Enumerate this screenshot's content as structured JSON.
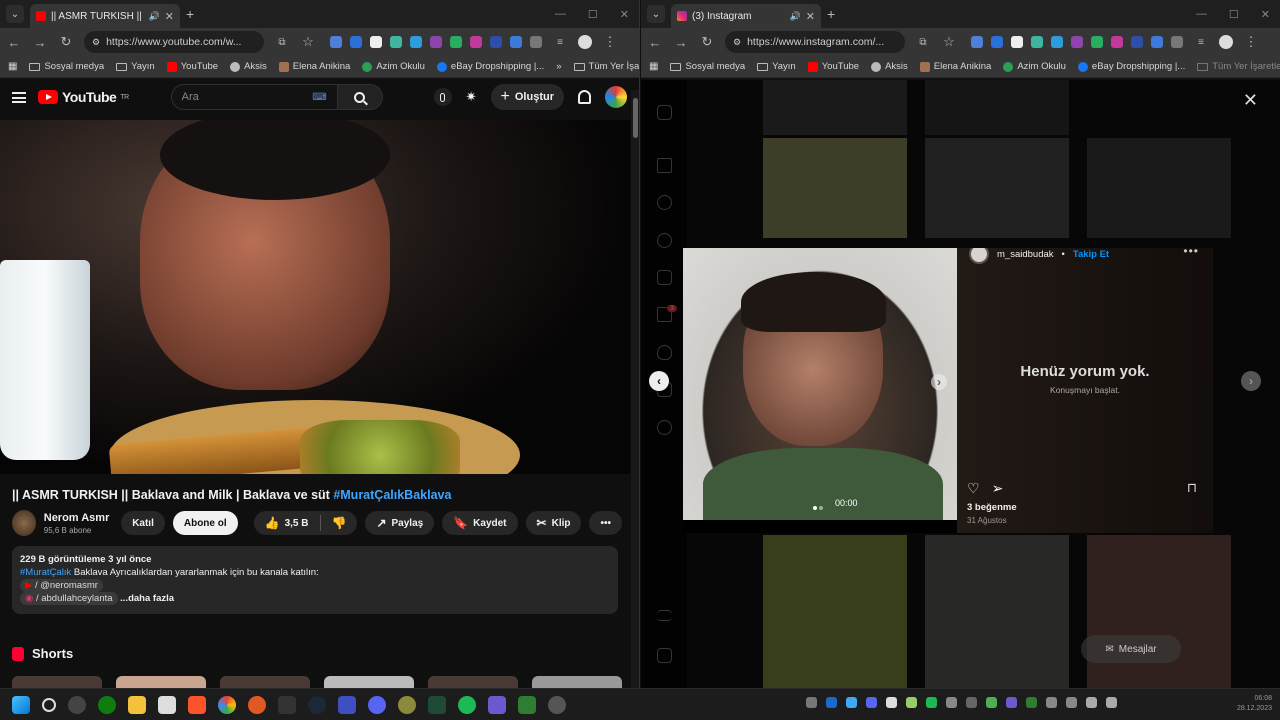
{
  "left_window": {
    "tab_title": "|| ASMR TURKISH || Baklav",
    "url": "https://www.youtube.com/w...",
    "bookmarks": [
      "Sosyal medya",
      "Yayın",
      "YouTube",
      "Aksis",
      "Elena Anikina",
      "Azim Okulu",
      "eBay Dropshipping |...",
      "Tüm Yer İşaretleri"
    ],
    "youtube": {
      "logo": "YouTube",
      "logo_region": "TR",
      "search_placeholder": "Ara",
      "create_label": "Oluştur",
      "video_title_main": "|| ASMR TURKISH || Baklava and Milk | Baklava ve süt",
      "video_title_tag": "#MuratÇalıkBaklava",
      "channel_name": "Nerom Asmr",
      "channel_subs": "95,6 B abone",
      "join_label": "Katıl",
      "subscribe_label": "Abone ol",
      "likes": "3,5 B",
      "share_label": "Paylaş",
      "save_label": "Kaydet",
      "clip_label": "Klip",
      "desc_views": "229 B görüntüleme  3 yıl önce",
      "desc_tag": "#MuratÇalık",
      "desc_line1": " Baklava Ayrıcalıklardan yararlanmak için bu kanala katılın:",
      "desc_line2": "/ @neromasmr",
      "desc_line3": "/ abdullahceylanta",
      "desc_more": "...daha fazla",
      "shorts_label": "Shorts"
    }
  },
  "right_window": {
    "tab_title": "(3) Instagram",
    "url": "https://www.instagram.com/...",
    "bookmarks": [
      "Sosyal medya",
      "Yayın",
      "YouTube",
      "Aksis",
      "Elena Anikina",
      "Azim Okulu",
      "eBay Dropshipping |...",
      "Tüm Yer İşaretleri"
    ],
    "instagram": {
      "username": "m_saidbudak",
      "follow_label": "Takip Et",
      "no_comments_title": "Henüz yorum yok.",
      "no_comments_sub": "Konuşmayı başlat.",
      "likes": "3 beğenme",
      "date": "31 Ağustos",
      "video_time": "00:00",
      "notification_count": "3",
      "messages_label": "Mesajlar"
    }
  },
  "taskbar": {
    "clock_time": "06:08",
    "clock_date": "28.12.2023"
  }
}
